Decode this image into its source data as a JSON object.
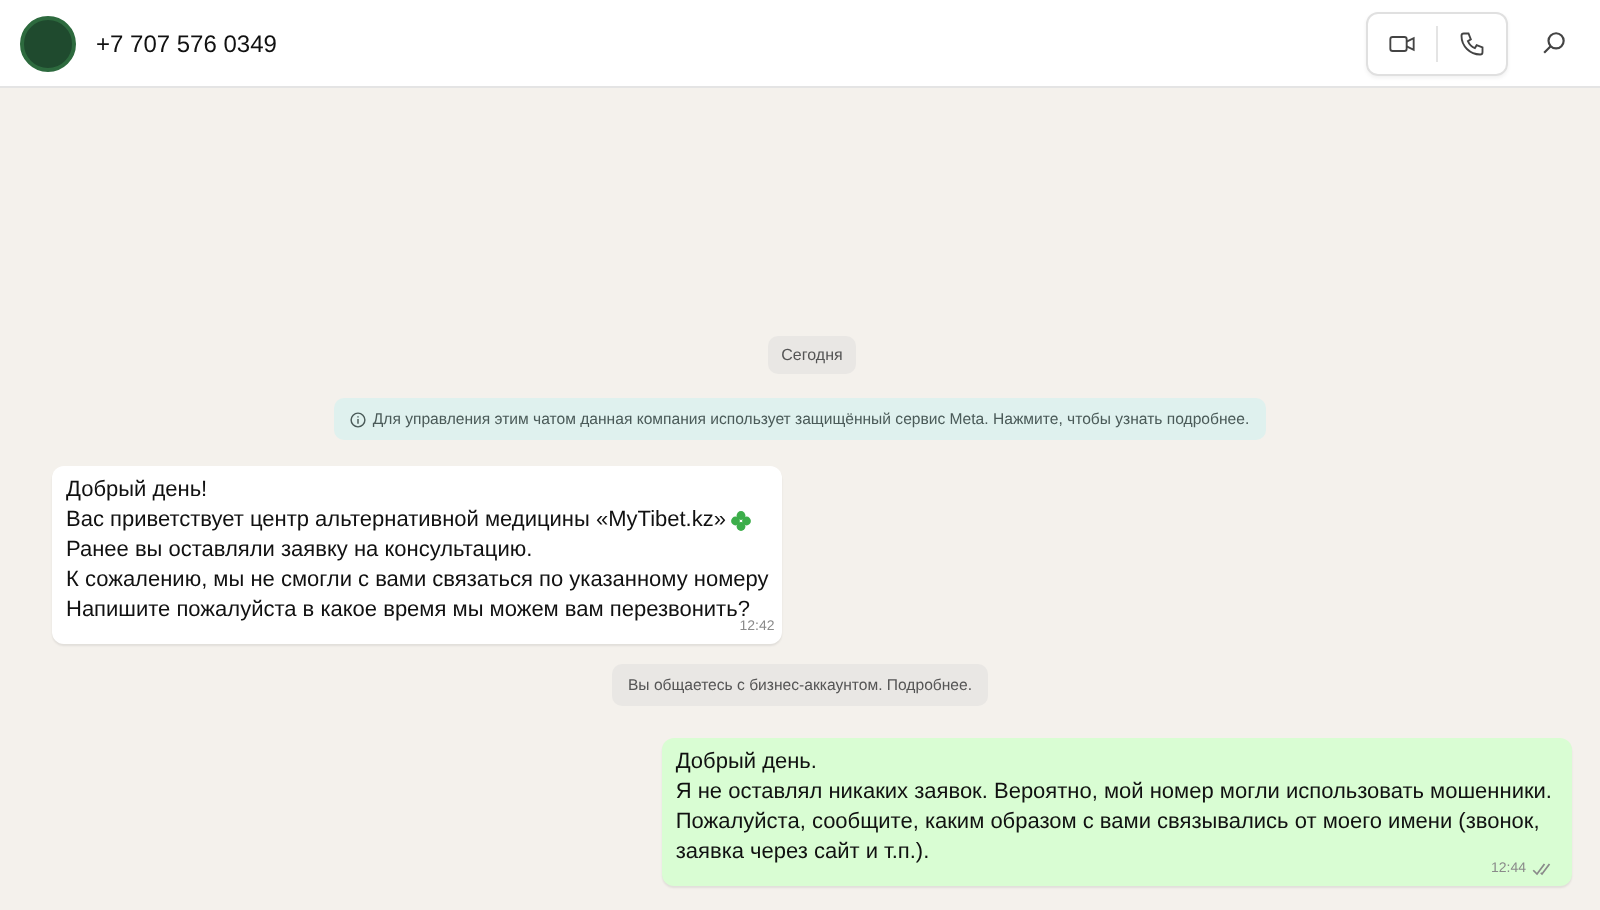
{
  "header": {
    "contact": "+7 707 576 0349"
  },
  "date_chip": "Сегодня",
  "info_notice": "Для управления этим чатом данная компания использует защищённый сервис Meta. Нажмите, чтобы узнать подробнее.",
  "messages": [
    {
      "kind": "in",
      "lines": [
        "Добрый день!",
        "Вас приветствует центр альтернативной медицины «MyTibet.kz»",
        "Ранее вы оставляли заявку на консультацию.",
        "К сожалению, мы не смогли с вами связаться по указанному номеру",
        "Напишите пожалуйста в какое время мы можем вам перезвонить?"
      ],
      "time": "12:42"
    },
    {
      "kind": "system",
      "text": "Вы общаетесь с бизнес-аккаунтом. Подробнее."
    },
    {
      "kind": "out",
      "lines": [
        "Добрый день.",
        "Я не оставлял никаких заявок. Вероятно, мой номер могли использовать мошенники.",
        "Пожалуйста, сообщите, каким образом с вами связывались от моего имени (звонок,",
        "заявка через сайт и т.п.)."
      ],
      "time": "12:44"
    }
  ]
}
